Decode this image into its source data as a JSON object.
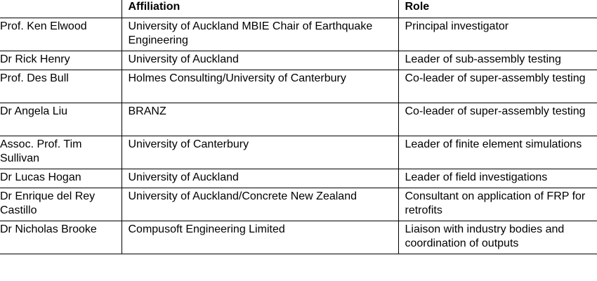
{
  "headers": {
    "name": "",
    "affiliation": "Affiliation",
    "role": "Role"
  },
  "rows": [
    {
      "name": "Prof. Ken Elwood",
      "affiliation": "University of Auckland MBIE Chair of Earthquake Engineering",
      "role": "Principal investigator"
    },
    {
      "name": "Dr Rick Henry",
      "affiliation": "University of Auckland",
      "role": "Leader of sub-assembly testing"
    },
    {
      "name": "Prof. Des Bull",
      "affiliation": "Holmes Consulting/University of Canterbury",
      "role": "Co-leader of super-assembly testing"
    },
    {
      "name": "Dr Angela Liu",
      "affiliation": "BRANZ",
      "role": "Co-leader of super-assembly testing"
    },
    {
      "name": "Assoc. Prof. Tim Sullivan",
      "affiliation": "University of Canterbury",
      "role": "Leader of finite element simulations"
    },
    {
      "name": "Dr Lucas Hogan",
      "affiliation": "University of Auckland",
      "role": "Leader of field investigations"
    },
    {
      "name": "Dr Enrique del Rey Castillo",
      "affiliation": "University of Auckland/Concrete New Zealand",
      "role": "Consultant on application of FRP for retrofits"
    },
    {
      "name": "Dr Nicholas Brooke",
      "affiliation": "Compusoft Engineering Limited",
      "role": "Liaison with industry bodies and coordination of outputs"
    }
  ]
}
